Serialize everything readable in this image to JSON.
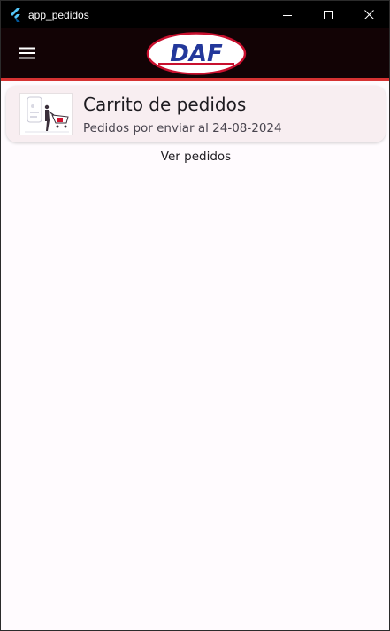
{
  "window": {
    "title": "app_pedidos",
    "controls": [
      "minimize-icon",
      "maximize-icon",
      "close-icon"
    ]
  },
  "appbar": {
    "menu_icon": "hamburger-menu-icon",
    "logo_text": "DAF",
    "accent_color": "#d63232",
    "background_color": "#120305"
  },
  "card": {
    "title": "Carrito de pedidos",
    "subtitle": "Pedidos por enviar al 24-08-2024",
    "thumbnail": "shopping-cart-illustration"
  },
  "view_link": "Ver pedidos"
}
